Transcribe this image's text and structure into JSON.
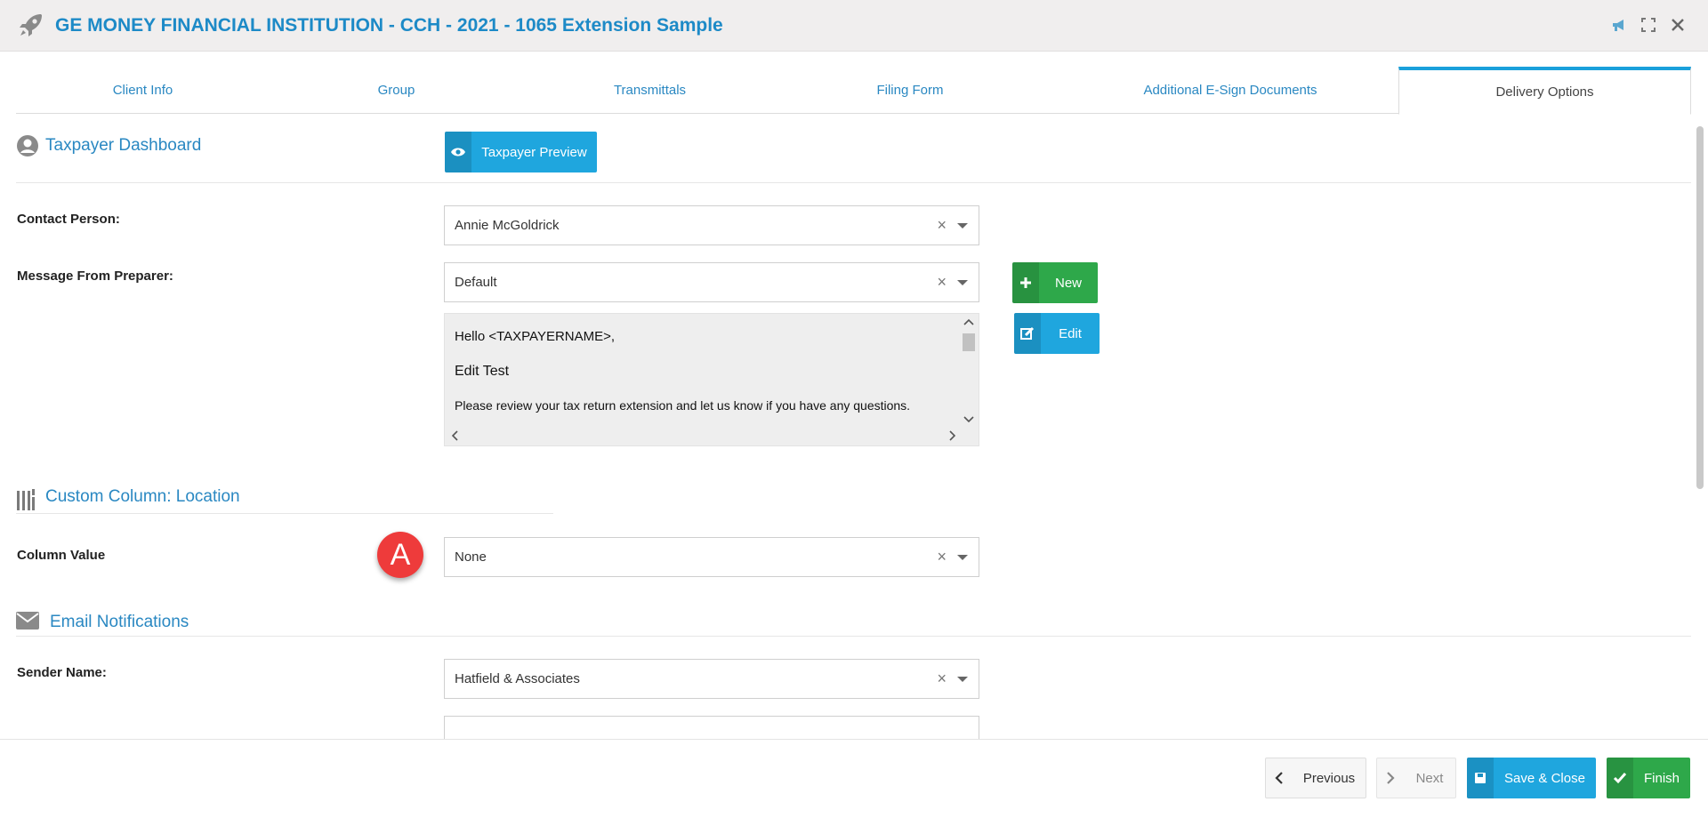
{
  "window": {
    "title": "GE MONEY FINANCIAL INSTITUTION - CCH - 2021 - 1065 Extension Sample"
  },
  "tabs": [
    {
      "label": "Client Info"
    },
    {
      "label": "Group"
    },
    {
      "label": "Transmittals"
    },
    {
      "label": "Filing Form"
    },
    {
      "label": "Additional E-Sign Documents"
    },
    {
      "label": "Delivery Options",
      "active": true
    }
  ],
  "taxpayer_dashboard": {
    "title": "Taxpayer Dashboard",
    "preview_button": "Taxpayer Preview",
    "contact_label": "Contact Person:",
    "contact_value": "Annie McGoldrick",
    "message_label": "Message From Preparer:",
    "message_value": "Default",
    "new_button": "New",
    "edit_button": "Edit",
    "message_lines": [
      "Hello <TAXPAYERNAME>,",
      "Edit Test",
      "Please review your tax return extension and let us know if you have any questions."
    ]
  },
  "custom_column": {
    "title": "Custom Column: Location",
    "value_label": "Column Value",
    "value": "None",
    "badge": "A"
  },
  "email_notifications": {
    "title": "Email Notifications",
    "sender_label": "Sender Name:",
    "sender_value": "Hatfield & Associates"
  },
  "footer": {
    "previous": "Previous",
    "next": "Next",
    "save_close": "Save & Close",
    "finish": "Finish"
  },
  "colors": {
    "accent": "#1d8ac7",
    "tab_active_border": "#1aa0db",
    "blue_button": "#1fa6de",
    "green_button": "#2ea84a",
    "badge": "#ee3b3b"
  },
  "icons": {
    "app": "rocket-icon",
    "announce": "megaphone-icon",
    "expand": "expand-icon",
    "close": "close-icon",
    "dashboard": "user-circle-icon",
    "preview": "eye-icon",
    "new": "plus-icon",
    "edit": "edit-icon",
    "custom_column": "columns-icon",
    "email": "envelope-icon",
    "previous": "chevron-left-icon",
    "next": "chevron-right-icon",
    "save": "floppy-icon",
    "finish": "check-icon"
  }
}
